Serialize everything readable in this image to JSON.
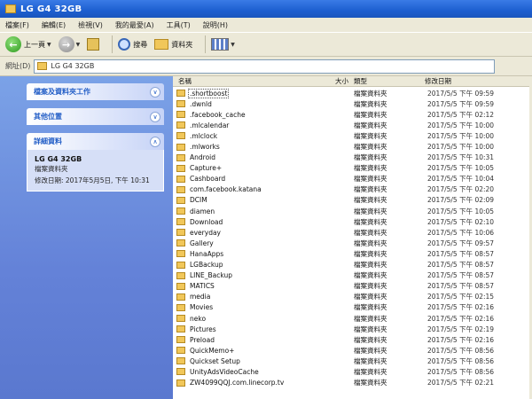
{
  "window": {
    "title": "LG G4 32GB"
  },
  "menu": [
    "檔案(F)",
    "編輯(E)",
    "檢視(V)",
    "我的最愛(A)",
    "工具(T)",
    "說明(H)"
  ],
  "toolbar": {
    "back_label": "上一頁",
    "search_label": "搜尋",
    "folders_label": "資料夾"
  },
  "address": {
    "label": "網址(D)",
    "value": "LG G4 32GB"
  },
  "taskpane": {
    "sections": [
      {
        "title": "檔案及資料夾工作"
      },
      {
        "title": "其他位置"
      },
      {
        "title": "詳細資料"
      }
    ],
    "details": {
      "name": "LG G4 32GB",
      "type": "檔案資料夾",
      "modified": "修改日期: 2017年5月5日, 下午 10:31"
    }
  },
  "columns": {
    "name": "名稱",
    "size": "大小",
    "type": "類型",
    "date": "修改日期"
  },
  "files": [
    {
      "name": ".shortboost",
      "type": "檔案資料夾",
      "date": "2017/5/5 下午 09:59"
    },
    {
      "name": ".dwnld",
      "type": "檔案資料夾",
      "date": "2017/5/5 下午 09:59"
    },
    {
      "name": ".facebook_cache",
      "type": "檔案資料夾",
      "date": "2017/5/5 下午 02:12"
    },
    {
      "name": ".mlcalendar",
      "type": "檔案資料夾",
      "date": "2017/5/5 下午 10:00"
    },
    {
      "name": ".mlclock",
      "type": "檔案資料夾",
      "date": "2017/5/5 下午 10:00"
    },
    {
      "name": ".mlworks",
      "type": "檔案資料夾",
      "date": "2017/5/5 下午 10:00"
    },
    {
      "name": "Android",
      "type": "檔案資料夾",
      "date": "2017/5/5 下午 10:31"
    },
    {
      "name": "Capture+",
      "type": "檔案資料夾",
      "date": "2017/5/5 下午 10:05"
    },
    {
      "name": "Cashboard",
      "type": "檔案資料夾",
      "date": "2017/5/5 下午 10:04"
    },
    {
      "name": "com.facebook.katana",
      "type": "檔案資料夾",
      "date": "2017/5/5 下午 02:20"
    },
    {
      "name": "DCIM",
      "type": "檔案資料夾",
      "date": "2017/5/5 下午 02:09"
    },
    {
      "name": "diamen",
      "type": "檔案資料夾",
      "date": "2017/5/5 下午 10:05"
    },
    {
      "name": "Download",
      "type": "檔案資料夾",
      "date": "2017/5/5 下午 02:10"
    },
    {
      "name": "everyday",
      "type": "檔案資料夾",
      "date": "2017/5/5 下午 10:06"
    },
    {
      "name": "Gallery",
      "type": "檔案資料夾",
      "date": "2017/5/5 下午 09:57"
    },
    {
      "name": "HanaApps",
      "type": "檔案資料夾",
      "date": "2017/5/5 下午 08:57"
    },
    {
      "name": "LGBackup",
      "type": "檔案資料夾",
      "date": "2017/5/5 下午 08:57"
    },
    {
      "name": "LINE_Backup",
      "type": "檔案資料夾",
      "date": "2017/5/5 下午 08:57"
    },
    {
      "name": "MATICS",
      "type": "檔案資料夾",
      "date": "2017/5/5 下午 08:57"
    },
    {
      "name": "media",
      "type": "檔案資料夾",
      "date": "2017/5/5 下午 02:15"
    },
    {
      "name": "Movies",
      "type": "檔案資料夾",
      "date": "2017/5/5 下午 02:16"
    },
    {
      "name": "neko",
      "type": "檔案資料夾",
      "date": "2017/5/5 下午 02:16"
    },
    {
      "name": "Pictures",
      "type": "檔案資料夾",
      "date": "2017/5/5 下午 02:19"
    },
    {
      "name": "Preload",
      "type": "檔案資料夾",
      "date": "2017/5/5 下午 02:16"
    },
    {
      "name": "QuickMemo+",
      "type": "檔案資料夾",
      "date": "2017/5/5 下午 08:56"
    },
    {
      "name": "Quickset Setup",
      "type": "檔案資料夾",
      "date": "2017/5/5 下午 08:56"
    },
    {
      "name": "UnityAdsVideoCache",
      "type": "檔案資料夾",
      "date": "2017/5/5 下午 08:56"
    },
    {
      "name": "ZW4099QQJ.com.linecorp.tv",
      "type": "檔案資料夾",
      "date": "2017/5/5 下午 02:21"
    }
  ]
}
